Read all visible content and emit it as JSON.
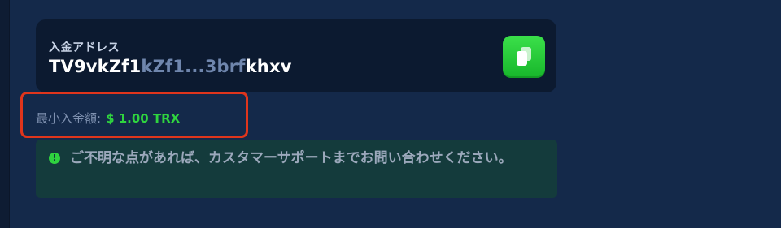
{
  "deposit": {
    "address_label": "入金アドレス",
    "address_start": "TV9vkZf1",
    "address_middle": "kZf1...3brf",
    "address_end": "khxv",
    "copy_icon": "copy-icon",
    "min_label": "最小入金額:",
    "min_value": "$ 1.00 TRX",
    "notice_icon": "info-icon",
    "notice_text": "ご不明な点があれば、カスタマーサポートまでお問い合わせください。"
  },
  "colors": {
    "background": "#0e1c33",
    "panel": "#14294a",
    "card": "#0c1a30",
    "accent_green": "#2fd33f",
    "highlight_red": "#e0351c",
    "notice_bg": "#143b3c"
  }
}
